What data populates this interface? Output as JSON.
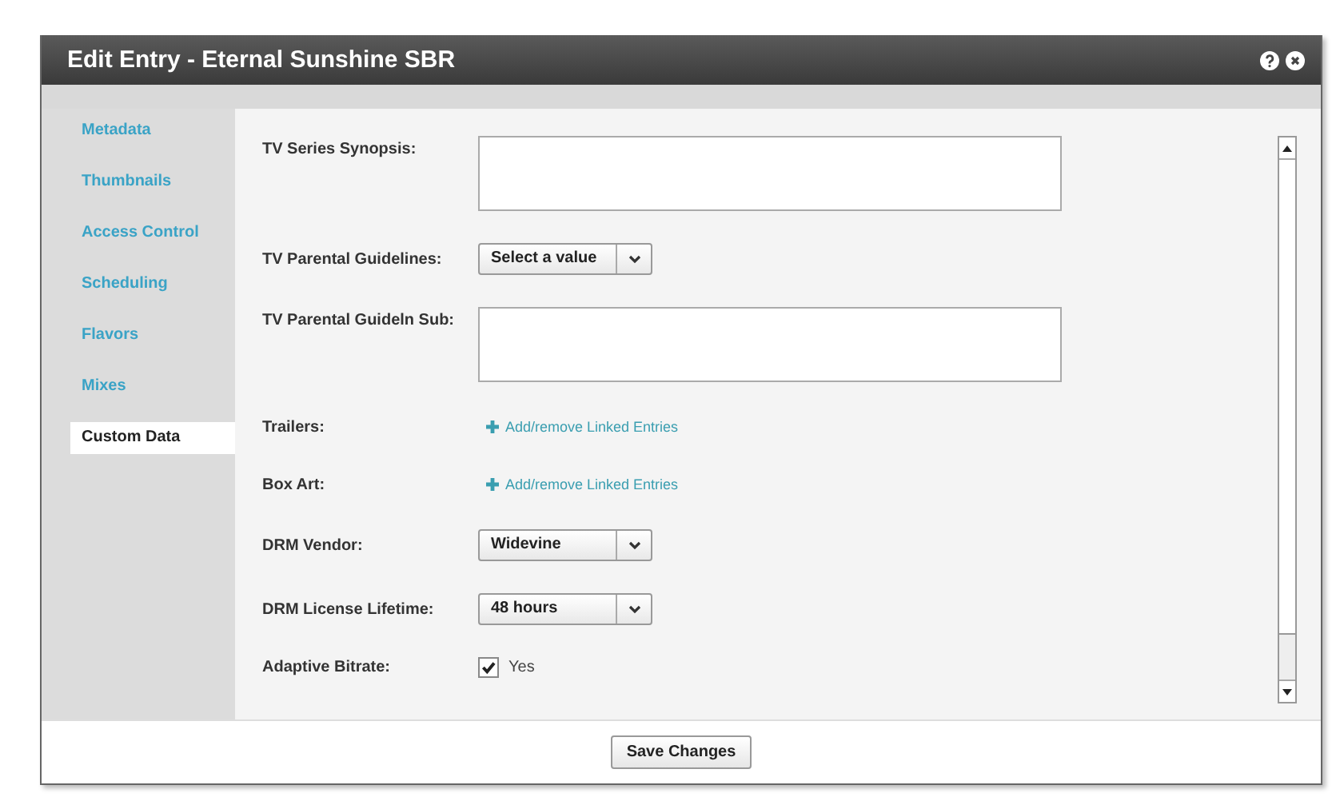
{
  "window": {
    "title": "Edit Entry - Eternal Sunshine SBR"
  },
  "sidebar": {
    "items": [
      {
        "label": "Metadata",
        "selected": false
      },
      {
        "label": "Thumbnails",
        "selected": false
      },
      {
        "label": "Access Control",
        "selected": false
      },
      {
        "label": "Scheduling",
        "selected": false
      },
      {
        "label": "Flavors",
        "selected": false
      },
      {
        "label": "Mixes",
        "selected": false
      },
      {
        "label": "Custom Data",
        "selected": true
      }
    ]
  },
  "fields": [
    {
      "kind": "textarea",
      "label": "TV Series Synopsis:"
    },
    {
      "kind": "select",
      "label": "TV Parental Guidelines:",
      "value": "Select a value"
    },
    {
      "kind": "textarea",
      "label": "TV Parental Guideln Sub:"
    },
    {
      "kind": "link",
      "label": "Trailers:",
      "value": "Add/remove Linked Entries"
    },
    {
      "kind": "link",
      "label": "Box Art:",
      "value": "Add/remove Linked Entries"
    },
    {
      "kind": "select",
      "label": "DRM Vendor:",
      "value": "Widevine"
    },
    {
      "kind": "select",
      "label": "DRM License Lifetime:",
      "value": "48 hours"
    },
    {
      "kind": "checkbox",
      "label": "Adaptive Bitrate:",
      "value": "Yes",
      "checked": true
    }
  ],
  "footer": {
    "button": "Save Changes"
  }
}
